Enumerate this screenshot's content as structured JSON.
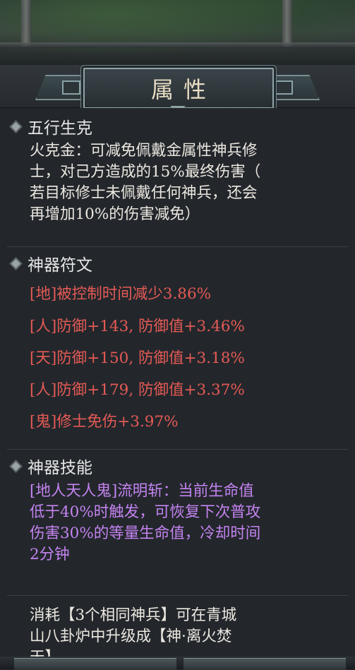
{
  "header": {
    "title": "属性"
  },
  "wuxing": {
    "title": "五行生克",
    "lines": [
      "火克金：可减免佩戴金属性神兵修",
      "士，对己方造成的15%最终伤害（",
      "若目标修士未佩戴任何神兵，还会",
      "再增加10%的伤害减免）"
    ]
  },
  "runes": {
    "title": "神器符文",
    "items": [
      "[地]被控制时间减少3.86%",
      "[人]防御+143, 防御值+3.46%",
      "[天]防御+150, 防御值+3.18%",
      "[人]防御+179, 防御值+3.37%",
      "[鬼]修士免伤+3.97%"
    ],
    "color": "#e55a55"
  },
  "skill": {
    "title": "神器技能",
    "lines": [
      "[地人天人鬼]流明斩：当前生命值",
      "低于40%时触发，可恢复下次普攻",
      "伤害30%的等量生命值，冷却时间",
      "2分钟"
    ],
    "color": "#c483f0"
  },
  "upgrade": {
    "lines": [
      "消耗【3个相同神兵】可在青城",
      "山八卦炉中升级成【神·离火焚",
      "天】"
    ]
  }
}
